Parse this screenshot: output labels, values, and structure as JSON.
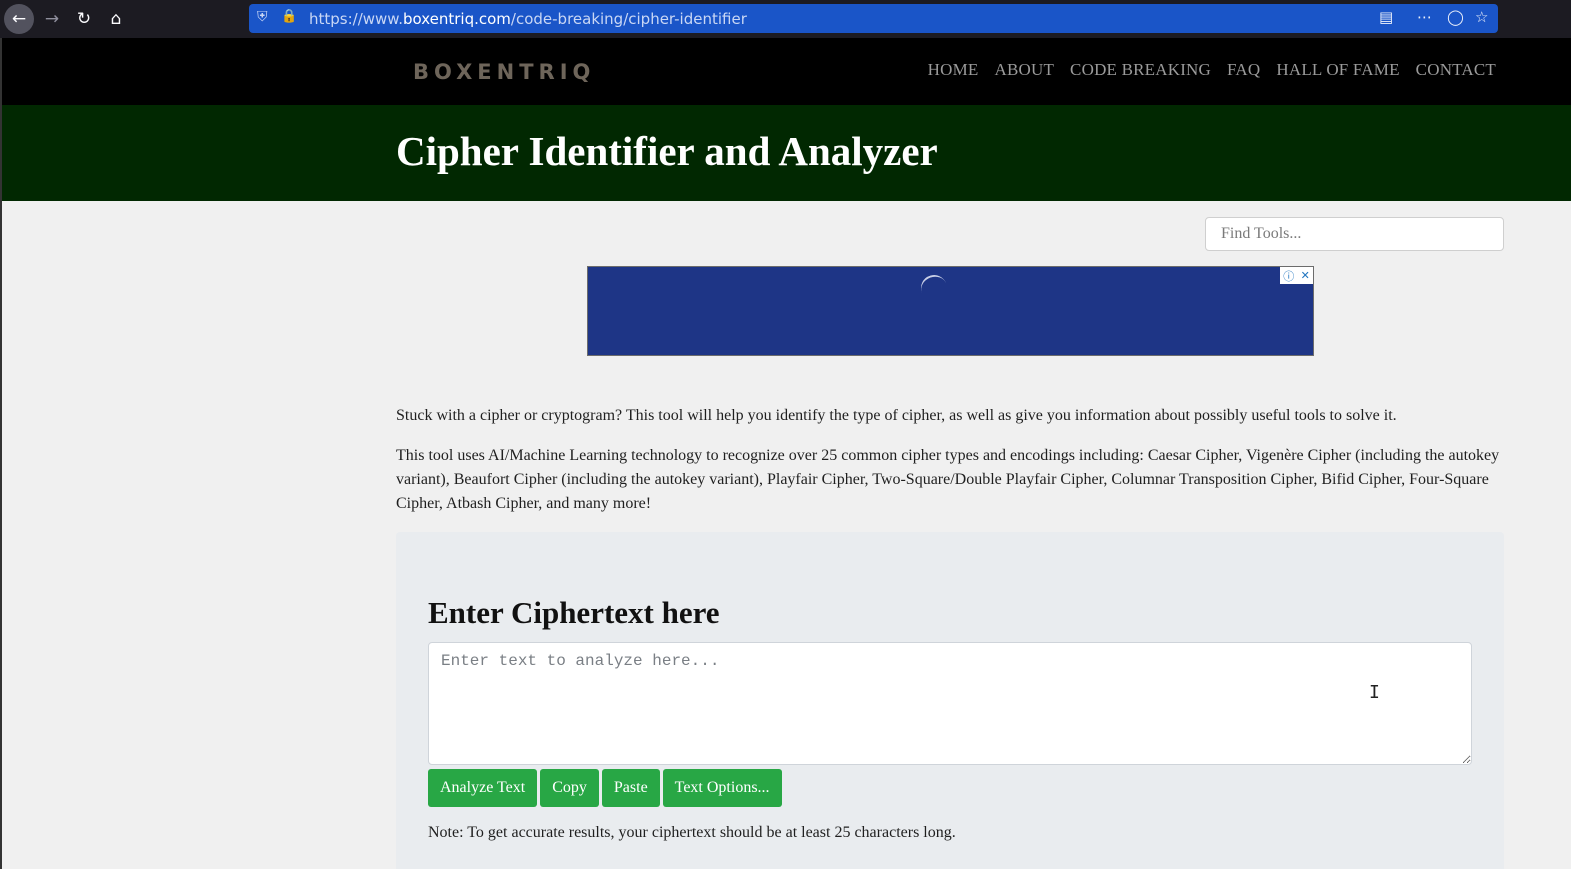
{
  "browser": {
    "url_prefix": "https://www.",
    "url_domain": "boxentriq.com",
    "url_path": "/code-breaking/cipher-identifier",
    "icons": [
      "back-arrow-icon",
      "forward-arrow-icon",
      "reload-icon",
      "home-icon",
      "shield-icon",
      "lock-icon",
      "reader-view-icon",
      "more-icon",
      "pocket-icon",
      "bookmark-star-icon"
    ]
  },
  "site": {
    "logo": "BOXENTRIQ",
    "nav": [
      "HOME",
      "ABOUT",
      "CODE BREAKING",
      "FAQ",
      "HALL OF FAME",
      "CONTACT"
    ],
    "title": "Cipher Identifier and Analyzer"
  },
  "search": {
    "placeholder": "Find Tools..."
  },
  "intro": {
    "p1": "Stuck with a cipher or cryptogram? This tool will help you identify the type of cipher, as well as give you information about possibly useful tools to solve it.",
    "p2": "This tool uses AI/Machine Learning technology to recognize over 25 common cipher types and encodings including: Caesar Cipher, Vigenère Cipher (including the autokey variant), Beaufort Cipher (including the autokey variant), Playfair Cipher, Two-Square/Double Playfair Cipher, Columnar Transposition Cipher, Bifid Cipher, Four-Square Cipher, Atbash Cipher, and many more!"
  },
  "analyzer": {
    "heading": "Enter Ciphertext here",
    "input_placeholder": "Enter text to analyze here...",
    "input_value": "",
    "buttons": {
      "analyze": "Analyze Text",
      "copy": "Copy",
      "paste": "Paste",
      "options": "Text Options..."
    },
    "note": "Note: To get accurate results, your ciphertext should be at least 25 characters long."
  },
  "colors": {
    "header_bg": "#000000",
    "title_band": "#012801",
    "button": "#28a745",
    "urlbar": "#1a55c8"
  }
}
